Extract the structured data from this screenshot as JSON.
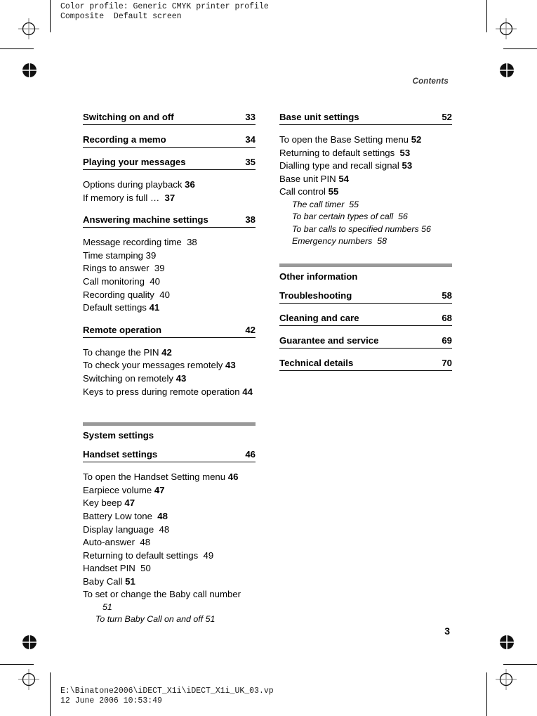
{
  "proof": {
    "header": "Color profile: Generic CMYK printer profile\nComposite  Default screen",
    "footer": "E:\\Binatone2006\\iDECT_X1i\\iDECT_X1i_UK_03.vp\n12 June 2006 10:53:49"
  },
  "page": {
    "running_head": "Contents",
    "folio": "3"
  },
  "colors": {
    "band": "#999999",
    "rule": "#000000",
    "running_head": "#3a3a3a"
  },
  "left_column": {
    "chapters": [
      {
        "title": "Switching on and off",
        "page": "33"
      },
      {
        "title": "Recording a memo",
        "page": "34"
      },
      {
        "title": "Playing your messages",
        "page": "35"
      }
    ],
    "playing_entries": [
      {
        "text": "Options during playback",
        "page": "36"
      },
      {
        "text": "If memory is full …",
        "page": "37"
      }
    ],
    "answering": {
      "title": "Answering machine settings",
      "page": "38"
    },
    "answering_entries": [
      {
        "text": "Message recording time",
        "page": "38",
        "bold": false
      },
      {
        "text": "Time stamping",
        "page": "39",
        "bold": false
      },
      {
        "text": "Rings to answer",
        "page": "39",
        "bold": false
      },
      {
        "text": "Call monitoring",
        "page": "40",
        "bold": false
      },
      {
        "text": "Recording quality",
        "page": "40",
        "bold": false
      },
      {
        "text": "Default settings",
        "page": "41",
        "bold": true
      }
    ],
    "remote": {
      "title": "Remote operation",
      "page": "42"
    },
    "remote_entries": [
      {
        "text": "To change the PIN",
        "page": "42"
      },
      {
        "text": "To check your messages remotely",
        "page": "43"
      },
      {
        "text": "Switching on remotely",
        "page": "43"
      },
      {
        "text": "Keys to press during remote operation",
        "page": "44"
      }
    ],
    "system_group": "System settings",
    "handset": {
      "title": "Handset settings",
      "page": "46"
    },
    "handset_entries": [
      {
        "text": "To open the Handset Setting menu",
        "page": "46",
        "bold": true
      },
      {
        "text": "Earpiece volume",
        "page": "47",
        "bold": true
      },
      {
        "text": "Key beep",
        "page": "47",
        "bold": true
      },
      {
        "text": "Battery Low tone",
        "page": "48",
        "bold": true
      },
      {
        "text": "Display language",
        "page": "48",
        "bold": false
      },
      {
        "text": "Auto-answer",
        "page": "48",
        "bold": false
      },
      {
        "text": "Returning to default settings",
        "page": "49",
        "bold": false
      },
      {
        "text": "Handset PIN",
        "page": "50",
        "bold": false
      },
      {
        "text": "Baby Call",
        "page": "51",
        "bold": true
      },
      {
        "text": "To set or change the Baby call   number",
        "page": "51",
        "bold": false
      }
    ],
    "baby_sub": {
      "text": "To turn Baby Call on and off",
      "page": "51"
    }
  },
  "right_column": {
    "base_unit": {
      "title": "Base unit settings",
      "page": "52"
    },
    "base_entries": [
      {
        "text": "To open the Base Setting menu",
        "page": "52"
      },
      {
        "text": "Returning to default settings",
        "page": "53"
      },
      {
        "text": "Dialling type and recall signal",
        "page": "53"
      },
      {
        "text": "Base unit PIN",
        "page": "54"
      },
      {
        "text": "Call control",
        "page": "55"
      }
    ],
    "call_control_subs": [
      {
        "text": "The call timer",
        "page": "55"
      },
      {
        "text": "To bar certain types of call",
        "page": "56"
      },
      {
        "text": "To bar calls to specified numbers",
        "page": "56"
      },
      {
        "text": "Emergency numbers",
        "page": "58"
      }
    ],
    "other_group": "Other information",
    "other_chapters": [
      {
        "title": "Troubleshooting",
        "page": "58"
      },
      {
        "title": "Cleaning and care",
        "page": "68"
      },
      {
        "title": "Guarantee and service",
        "page": "69"
      },
      {
        "title": "Technical details",
        "page": "70"
      }
    ]
  }
}
